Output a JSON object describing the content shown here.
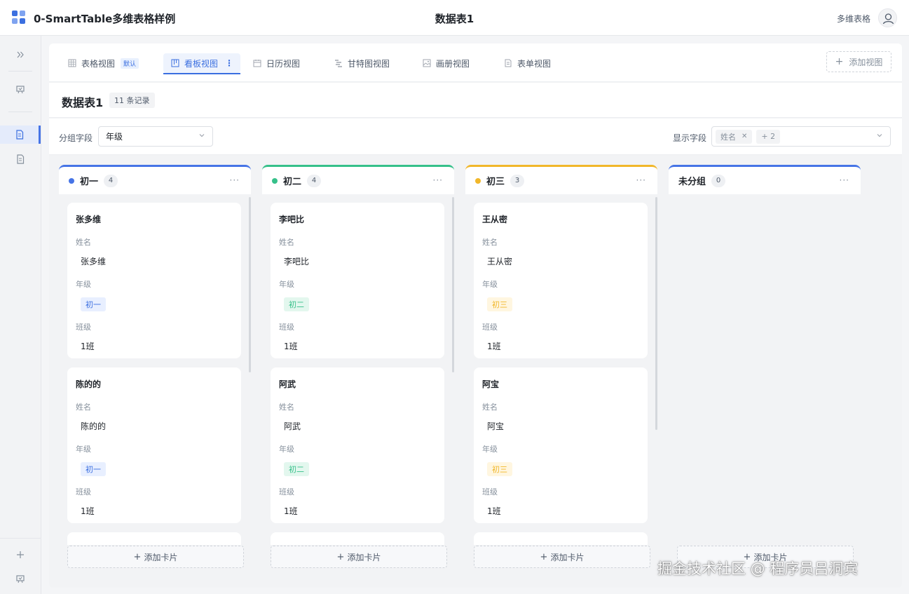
{
  "app": {
    "title": "0-SmartTable多维表格样例",
    "center_title": "数据表1",
    "right_label": "多维表格"
  },
  "colors": {
    "accent": "#3b6fe0",
    "chu1": "#4674e6",
    "chu2": "#36c08a",
    "chu3": "#f1b72a",
    "unassigned": "#4674e6"
  },
  "views": {
    "tabs": [
      {
        "label": "表格视图",
        "icon": "table-grid-icon",
        "badge": "默认"
      },
      {
        "label": "看板视图",
        "icon": "kanban-icon"
      },
      {
        "label": "日历视图",
        "icon": "calendar-icon"
      },
      {
        "label": "甘特图视图",
        "icon": "gantt-icon"
      },
      {
        "label": "画册视图",
        "icon": "image-icon"
      },
      {
        "label": "表单视图",
        "icon": "form-icon"
      }
    ],
    "active_index": 1,
    "add_label": "添加视图"
  },
  "table": {
    "name": "数据表1",
    "records": "11 条记录"
  },
  "filters": {
    "group_label": "分组字段",
    "group_value": "年级",
    "display_label": "显示字段",
    "display_tags": [
      "姓名"
    ],
    "display_more": "+ 2"
  },
  "columns": [
    {
      "name": "初一",
      "count": "4",
      "color": "#4674e6",
      "cards": [
        {
          "title": "张多维",
          "name": "张多维",
          "grade": "初一",
          "class": "1班"
        },
        {
          "title": "陈的的",
          "name": "陈的的",
          "grade": "初一",
          "class": "1班"
        }
      ]
    },
    {
      "name": "初二",
      "count": "4",
      "color": "#36c08a",
      "cards": [
        {
          "title": "李吧比",
          "name": "李吧比",
          "grade": "初二",
          "class": "1班"
        },
        {
          "title": "阿武",
          "name": "阿武",
          "grade": "初二",
          "class": "1班"
        }
      ]
    },
    {
      "name": "初三",
      "count": "3",
      "color": "#f1b72a",
      "cards": [
        {
          "title": "王从密",
          "name": "王从密",
          "grade": "初三",
          "class": "1班"
        },
        {
          "title": "阿宝",
          "name": "阿宝",
          "grade": "初三",
          "class": "1班"
        }
      ]
    },
    {
      "name": "未分组",
      "count": "0",
      "color": "#4674e6",
      "cards": []
    }
  ],
  "card_fields": {
    "name": "姓名",
    "grade": "年级",
    "class": "班级"
  },
  "add_card_label": "添加卡片",
  "watermark": "掘金技术社区 @ 程序员吕洞宾"
}
